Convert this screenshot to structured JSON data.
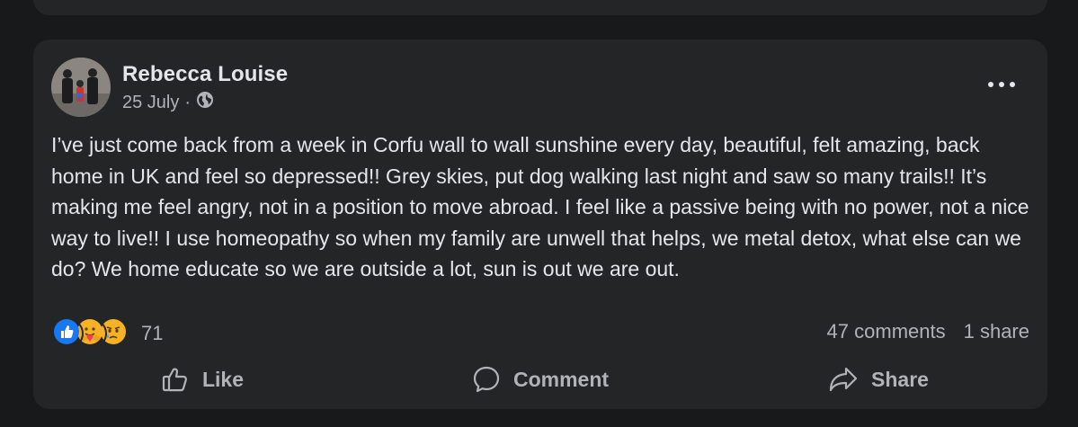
{
  "post": {
    "author": "Rebecca Louise",
    "date": "25 July",
    "separator": "·",
    "audience_icon": "globe-icon",
    "more_icon": "more-options-icon",
    "text": "I’ve just come back from a week in Corfu wall to wall sunshine every day, beautiful, felt amazing, back home in UK and feel so depressed!! Grey skies, put dog walking last night and saw so many trails!! It’s making me feel angry, not in a position to move abroad. I feel like a passive being with no power, not a nice way to live!! I use homeopathy so when my family are unwell that helps, we metal detox, what else can we do? We home educate so we are outside a lot, sun is out we are out."
  },
  "reactions": {
    "types": [
      "like",
      "care",
      "sad"
    ],
    "count": "71"
  },
  "stats": {
    "comments": "47 comments",
    "shares": "1 share"
  },
  "actions": {
    "like": "Like",
    "comment": "Comment",
    "share": "Share"
  },
  "colors": {
    "background": "#18191a",
    "card": "#242526",
    "primary_text": "#e4e6eb",
    "secondary_text": "#b0b3b8",
    "like_blue": "#1877f2"
  }
}
